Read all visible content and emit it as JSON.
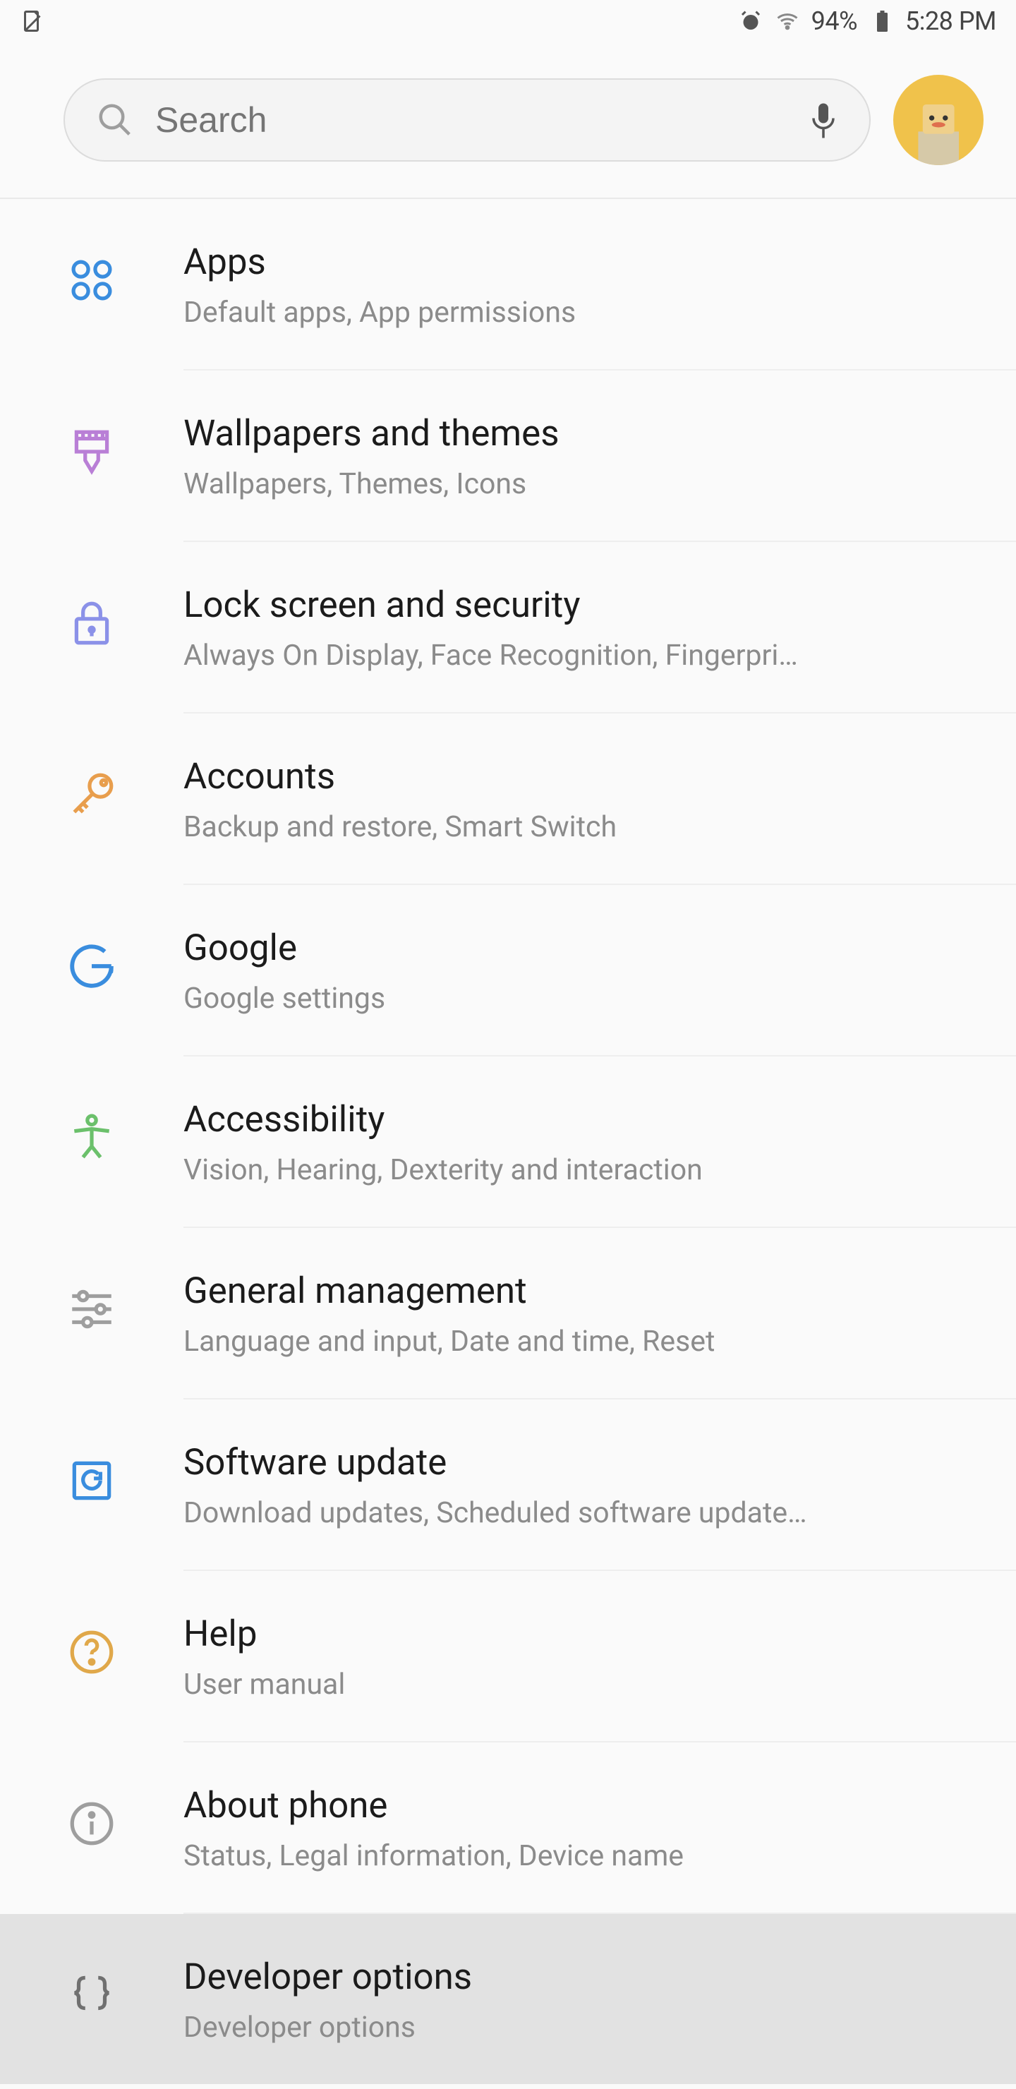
{
  "status_bar": {
    "battery_pct": "94%",
    "time": "5:28 PM"
  },
  "search": {
    "placeholder": "Search"
  },
  "items": [
    {
      "id": "apps",
      "title": "Apps",
      "subtitle": "Default apps, App permissions",
      "color": "#3a8dde"
    },
    {
      "id": "wallpapers",
      "title": "Wallpapers and themes",
      "subtitle": "Wallpapers, Themes, Icons",
      "color": "#b97fd6"
    },
    {
      "id": "lockscreen",
      "title": "Lock screen and security",
      "subtitle": "Always On Display, Face Recognition, Fingerpri…",
      "color": "#8b91e8"
    },
    {
      "id": "accounts",
      "title": "Accounts",
      "subtitle": "Backup and restore, Smart Switch",
      "color": "#e89e4d"
    },
    {
      "id": "google",
      "title": "Google",
      "subtitle": "Google settings",
      "color": "#3a8dde"
    },
    {
      "id": "accessibility",
      "title": "Accessibility",
      "subtitle": "Vision, Hearing, Dexterity and interaction",
      "color": "#6bc06b"
    },
    {
      "id": "general",
      "title": "General management",
      "subtitle": "Language and input, Date and time, Reset",
      "color": "#9e9e9e"
    },
    {
      "id": "swupdate",
      "title": "Software update",
      "subtitle": "Download updates, Scheduled software update…",
      "color": "#3a8dde"
    },
    {
      "id": "help",
      "title": "Help",
      "subtitle": "User manual",
      "color": "#e0a84a"
    },
    {
      "id": "about",
      "title": "About phone",
      "subtitle": "Status, Legal information, Device name",
      "color": "#9e9e9e"
    },
    {
      "id": "developer",
      "title": "Developer options",
      "subtitle": "Developer options",
      "color": "#707070"
    }
  ],
  "highlighted_item_id": "developer"
}
